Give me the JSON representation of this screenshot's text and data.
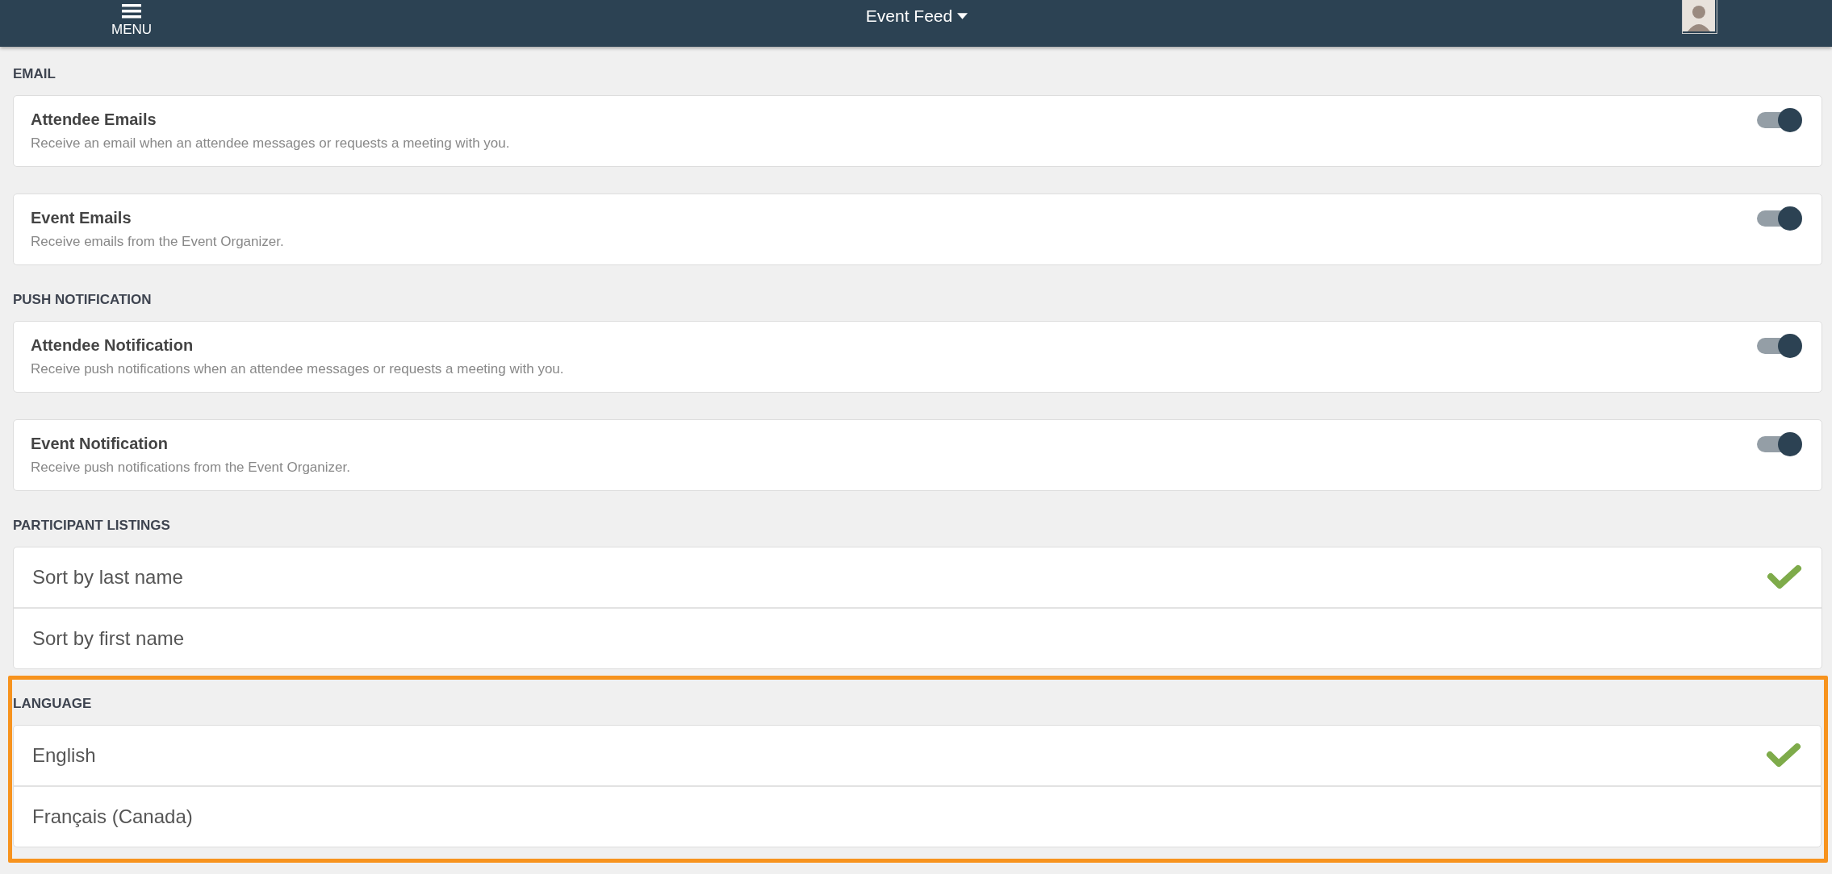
{
  "header": {
    "menu_label": "MENU",
    "title": "Event Feed"
  },
  "sections": [
    {
      "heading": "EMAIL",
      "kind": "toggles",
      "highlighted": false,
      "items": [
        {
          "title": "Attendee Emails",
          "description": "Receive an email when an attendee messages or requests a meeting with you.",
          "on": true
        },
        {
          "title": "Event Emails",
          "description": "Receive emails from the Event Organizer.",
          "on": true
        }
      ]
    },
    {
      "heading": "PUSH NOTIFICATION",
      "kind": "toggles",
      "highlighted": false,
      "items": [
        {
          "title": "Attendee Notification",
          "description": "Receive push notifications when an attendee messages or requests a meeting with you.",
          "on": true
        },
        {
          "title": "Event Notification",
          "description": "Receive push notifications from the Event Organizer.",
          "on": true
        }
      ]
    },
    {
      "heading": "PARTICIPANT LISTINGS",
      "kind": "options",
      "highlighted": false,
      "items": [
        {
          "label": "Sort by last name",
          "selected": true
        },
        {
          "label": "Sort by first name",
          "selected": false
        }
      ]
    },
    {
      "heading": "LANGUAGE",
      "kind": "options",
      "highlighted": true,
      "items": [
        {
          "label": "English",
          "selected": true
        },
        {
          "label": "Français (Canada)",
          "selected": false
        }
      ]
    }
  ]
}
